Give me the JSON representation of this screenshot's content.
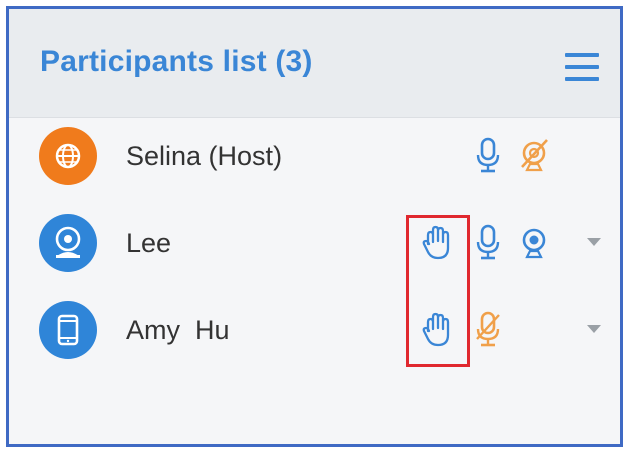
{
  "panel": {
    "title": "Participants list (3)",
    "menu_icon": "hamburger-menu-icon"
  },
  "participants": [
    {
      "name": "Selina (Host)",
      "avatar_icon": "globe-icon",
      "avatar_color": "#f07b1c",
      "hand_raised": false,
      "mic_icon": "microphone-icon",
      "mic_status": "on",
      "camera_icon": "camera-off-icon",
      "camera_status": "off",
      "has_dropdown": false
    },
    {
      "name": "Lee",
      "avatar_icon": "webcam-icon",
      "avatar_color": "#2f85d8",
      "hand_raised": true,
      "hand_icon": "raised-hand-icon",
      "mic_icon": "microphone-icon",
      "mic_status": "on",
      "camera_icon": "camera-icon",
      "camera_status": "on",
      "has_dropdown": true
    },
    {
      "name": "Amy  Hu",
      "avatar_icon": "mobile-phone-icon",
      "avatar_color": "#2f85d8",
      "hand_raised": true,
      "hand_icon": "raised-hand-icon",
      "mic_icon": "microphone-muted-icon",
      "mic_status": "muted",
      "has_dropdown": true
    }
  ],
  "colors": {
    "accent": "#3a86d6",
    "warning": "#f0a04a",
    "highlight": "#e0282f"
  }
}
